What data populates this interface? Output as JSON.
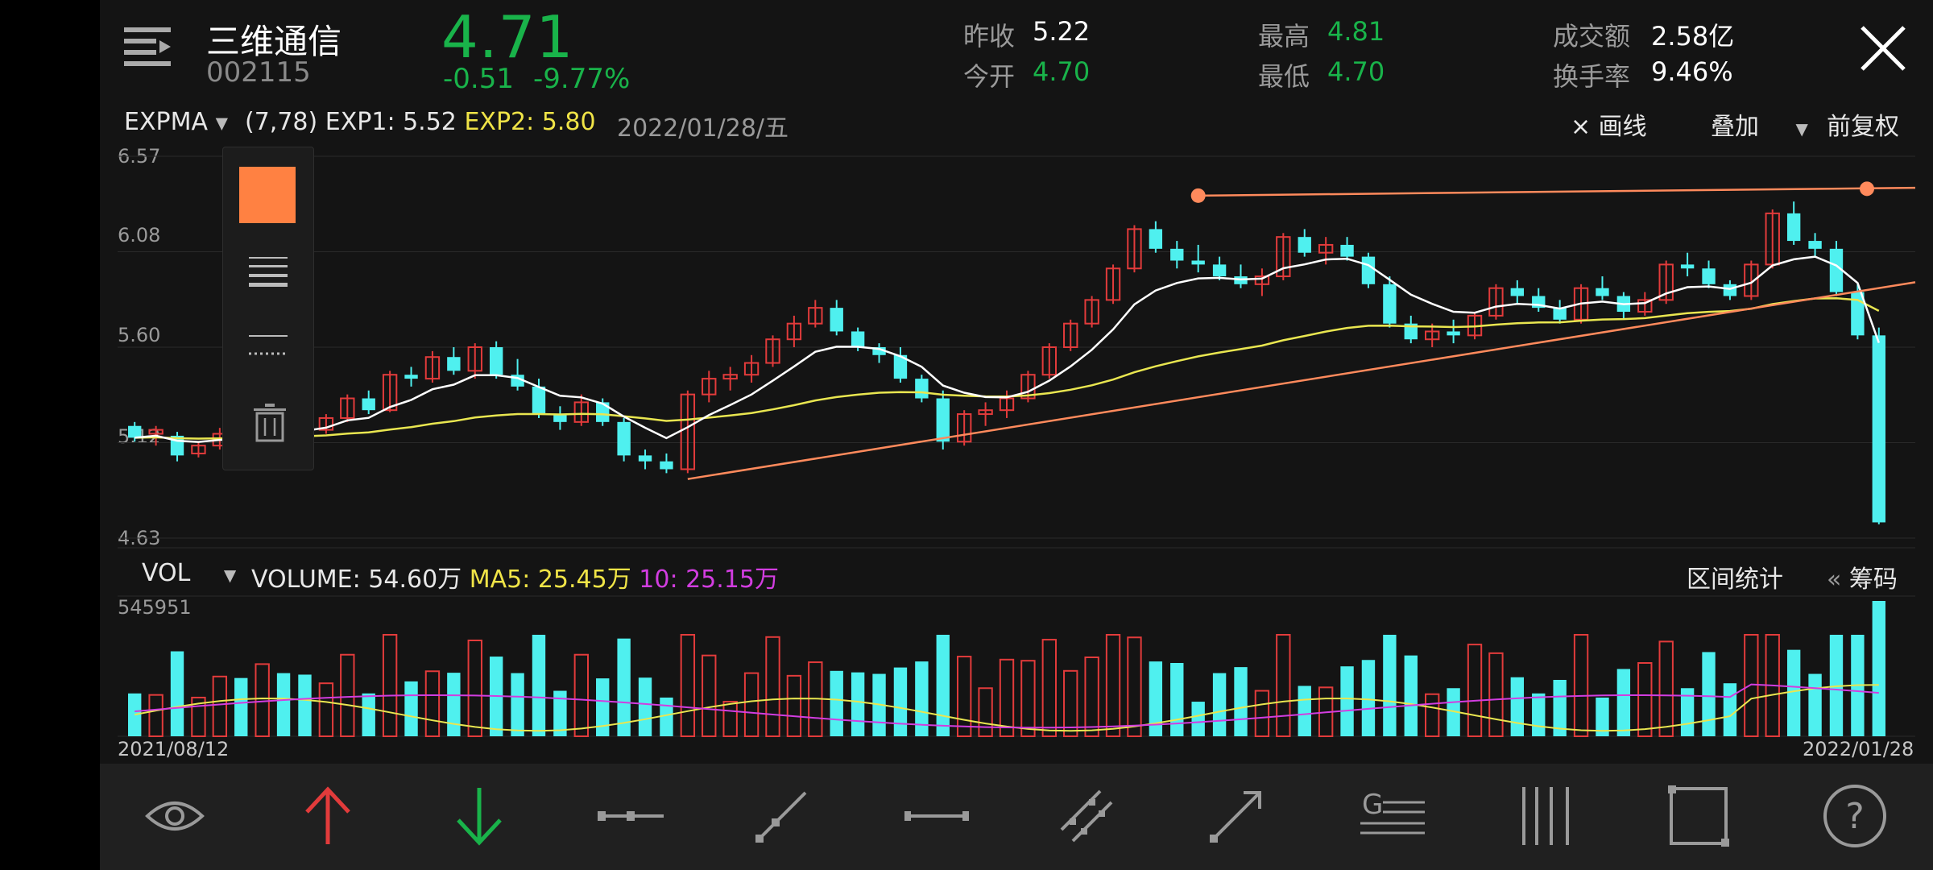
{
  "stock": {
    "name": "三维通信",
    "code": "002115",
    "price": "4.71",
    "change": "-0.51",
    "change_pct": "-9.77%"
  },
  "stats": {
    "prev_close_label": "昨收",
    "prev_close": "5.22",
    "open_label": "今开",
    "open": "4.70",
    "high_label": "最高",
    "high": "4.81",
    "low_label": "最低",
    "low": "4.70",
    "turnover_label": "成交额",
    "turnover": "2.58亿",
    "turnover_rate_label": "换手率",
    "turnover_rate": "9.46%"
  },
  "indicator_bar": {
    "indicator": "EXPMA",
    "params": "(7,78)",
    "exp1": "EXP1: 5.52",
    "exp2": "EXP2: 5.80",
    "date": "2022/01/28/五",
    "draw_label": "× 画线",
    "overlay_label": "叠加",
    "adjust_label": "前复权"
  },
  "price_axis": [
    "6.57",
    "6.08",
    "5.60",
    "5.12",
    "4.63"
  ],
  "volume_bar": {
    "indicator": "VOL",
    "volume": "VOLUME: 54.60万",
    "ma5": "MA5: 25.45万",
    "ma10": "10: 25.15万",
    "range_stats": "区间统计",
    "chips": "筹码",
    "chips_prefix": "«"
  },
  "volume_axis_max": "545951",
  "date_range": {
    "start": "2021/08/12",
    "end": "2022/01/28"
  },
  "colors": {
    "up": "#e23b3b",
    "down": "#4ff0ef",
    "exp1": "#ffffff",
    "exp2": "#e9e650",
    "trendline": "#ff8a5c",
    "selected_color": "#ff8142",
    "ma10": "#d23de0"
  },
  "toolbar_icons": [
    "eye-icon",
    "arrow-up-icon",
    "arrow-down-icon",
    "segment-icon",
    "ray-icon",
    "horizontal-line-icon",
    "parallel-channel-icon",
    "arrow-line-icon",
    "gann-icon",
    "vertical-lines-icon",
    "rectangle-icon",
    "help-icon"
  ],
  "chart_data": {
    "type": "candlestick",
    "x_range": [
      "2021/08/12",
      "2022/01/28"
    ],
    "price_axis_ticks": [
      6.57,
      6.08,
      5.6,
      5.12,
      4.63
    ],
    "ylim": [
      4.63,
      6.57
    ],
    "ohlc_approx": [
      [
        5.2,
        5.22,
        5.12,
        5.14
      ],
      [
        5.16,
        5.2,
        5.1,
        5.18
      ],
      [
        5.15,
        5.17,
        5.02,
        5.05
      ],
      [
        5.06,
        5.12,
        5.04,
        5.1
      ],
      [
        5.1,
        5.19,
        5.08,
        5.16
      ],
      [
        5.16,
        5.21,
        5.13,
        5.14
      ],
      [
        5.14,
        5.28,
        5.12,
        5.26
      ],
      [
        5.26,
        5.3,
        5.18,
        5.2
      ],
      [
        5.2,
        5.24,
        5.14,
        5.18
      ],
      [
        5.18,
        5.26,
        5.16,
        5.24
      ],
      [
        5.24,
        5.36,
        5.22,
        5.34
      ],
      [
        5.34,
        5.38,
        5.26,
        5.28
      ],
      [
        5.28,
        5.48,
        5.27,
        5.46
      ],
      [
        5.46,
        5.5,
        5.4,
        5.44
      ],
      [
        5.44,
        5.58,
        5.42,
        5.55
      ],
      [
        5.55,
        5.6,
        5.46,
        5.48
      ],
      [
        5.48,
        5.62,
        5.44,
        5.6
      ],
      [
        5.6,
        5.63,
        5.44,
        5.46
      ],
      [
        5.46,
        5.54,
        5.38,
        5.4
      ],
      [
        5.4,
        5.44,
        5.24,
        5.26
      ],
      [
        5.26,
        5.3,
        5.18,
        5.22
      ],
      [
        5.22,
        5.36,
        5.2,
        5.32
      ],
      [
        5.32,
        5.34,
        5.2,
        5.22
      ],
      [
        5.22,
        5.24,
        5.02,
        5.05
      ],
      [
        5.05,
        5.08,
        4.98,
        5.02
      ],
      [
        5.02,
        5.06,
        4.96,
        4.98
      ],
      [
        4.98,
        5.38,
        4.96,
        5.36
      ],
      [
        5.36,
        5.48,
        5.32,
        5.44
      ],
      [
        5.44,
        5.5,
        5.38,
        5.46
      ],
      [
        5.46,
        5.56,
        5.42,
        5.52
      ],
      [
        5.52,
        5.66,
        5.5,
        5.64
      ],
      [
        5.64,
        5.76,
        5.6,
        5.72
      ],
      [
        5.72,
        5.84,
        5.7,
        5.8
      ],
      [
        5.8,
        5.84,
        5.66,
        5.68
      ],
      [
        5.68,
        5.7,
        5.58,
        5.6
      ],
      [
        5.6,
        5.62,
        5.52,
        5.56
      ],
      [
        5.56,
        5.6,
        5.42,
        5.44
      ],
      [
        5.44,
        5.46,
        5.32,
        5.34
      ],
      [
        5.34,
        5.38,
        5.08,
        5.12
      ],
      [
        5.12,
        5.28,
        5.1,
        5.26
      ],
      [
        5.26,
        5.32,
        5.2,
        5.28
      ],
      [
        5.28,
        5.38,
        5.24,
        5.34
      ],
      [
        5.34,
        5.48,
        5.32,
        5.46
      ],
      [
        5.46,
        5.62,
        5.44,
        5.6
      ],
      [
        5.6,
        5.74,
        5.58,
        5.72
      ],
      [
        5.72,
        5.86,
        5.7,
        5.84
      ],
      [
        5.84,
        6.02,
        5.82,
        6.0
      ],
      [
        6.0,
        6.22,
        5.98,
        6.2
      ],
      [
        6.2,
        6.24,
        6.08,
        6.1
      ],
      [
        6.1,
        6.14,
        6.0,
        6.04
      ],
      [
        6.04,
        6.12,
        5.98,
        6.02
      ],
      [
        6.02,
        6.06,
        5.94,
        5.96
      ],
      [
        5.96,
        6.02,
        5.9,
        5.92
      ],
      [
        5.92,
        6.0,
        5.86,
        5.96
      ],
      [
        5.96,
        6.18,
        5.94,
        6.16
      ],
      [
        6.16,
        6.2,
        6.06,
        6.08
      ],
      [
        6.08,
        6.16,
        6.02,
        6.12
      ],
      [
        6.12,
        6.16,
        6.04,
        6.06
      ],
      [
        6.06,
        6.08,
        5.9,
        5.92
      ],
      [
        5.92,
        5.96,
        5.7,
        5.72
      ],
      [
        5.72,
        5.76,
        5.62,
        5.64
      ],
      [
        5.64,
        5.72,
        5.6,
        5.68
      ],
      [
        5.68,
        5.74,
        5.62,
        5.66
      ],
      [
        5.66,
        5.78,
        5.64,
        5.76
      ],
      [
        5.76,
        5.92,
        5.74,
        5.9
      ],
      [
        5.9,
        5.94,
        5.82,
        5.86
      ],
      [
        5.86,
        5.9,
        5.78,
        5.8
      ],
      [
        5.8,
        5.84,
        5.72,
        5.74
      ],
      [
        5.74,
        5.92,
        5.72,
        5.9
      ],
      [
        5.9,
        5.96,
        5.84,
        5.86
      ],
      [
        5.86,
        5.88,
        5.74,
        5.78
      ],
      [
        5.78,
        5.88,
        5.76,
        5.84
      ],
      [
        5.84,
        6.04,
        5.82,
        6.02
      ],
      [
        6.02,
        6.08,
        5.96,
        6.0
      ],
      [
        6.0,
        6.04,
        5.9,
        5.92
      ],
      [
        5.92,
        5.94,
        5.84,
        5.86
      ],
      [
        5.86,
        6.04,
        5.84,
        6.02
      ],
      [
        6.02,
        6.3,
        6.0,
        6.28
      ],
      [
        6.28,
        6.34,
        6.12,
        6.14
      ],
      [
        6.14,
        6.18,
        6.06,
        6.1
      ],
      [
        6.1,
        6.14,
        5.86,
        5.88
      ],
      [
        5.88,
        5.92,
        5.64,
        5.66
      ],
      [
        5.66,
        5.7,
        4.7,
        4.71
      ]
    ],
    "series": [
      {
        "name": "EXP1",
        "latest": 5.52
      },
      {
        "name": "EXP2",
        "latest": 5.8
      }
    ],
    "volume": {
      "axis_max": 545951,
      "latest": "54.60万",
      "ma5": "25.45万",
      "ma10": "25.15万"
    }
  }
}
